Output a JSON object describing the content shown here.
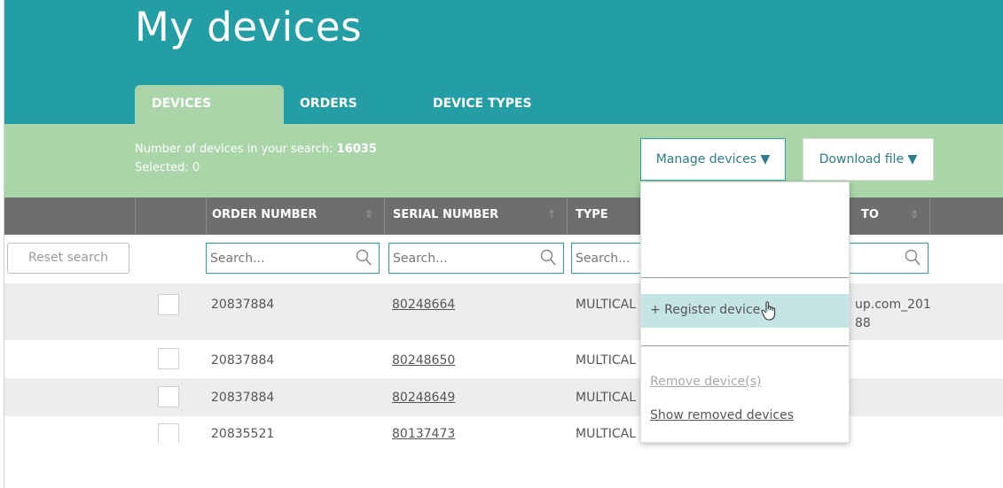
{
  "header": {
    "title": "My devices",
    "tabs": [
      {
        "label": "DEVICES",
        "active": true
      },
      {
        "label": "ORDERS",
        "active": false
      },
      {
        "label": "DEVICE TYPES",
        "active": false
      }
    ]
  },
  "summary": {
    "count_label": "Number of devices in your search: ",
    "count_value": "16035",
    "selected_label": "Selected: 0"
  },
  "actions": {
    "manage_label": "Manage devices ▼",
    "download_label": "Download file ▼"
  },
  "columns": {
    "order_number": "ORDER NUMBER",
    "serial_number": "SERIAL NUMBER",
    "type": "TYPE",
    "last": "TO"
  },
  "search": {
    "reset_label": "Reset search",
    "placeholder": "Search..."
  },
  "rows": [
    {
      "order": "20837884",
      "serial": "80248664",
      "type": "MULTICAL",
      "extra1": "up.com_201",
      "extra2": "88"
    },
    {
      "order": "20837884",
      "serial": "80248650",
      "type": "MULTICAL"
    },
    {
      "order": "20837884",
      "serial": "80248649",
      "type": "MULTICAL"
    },
    {
      "order": "20835521",
      "serial": "80137473",
      "type": "MULTICAL"
    }
  ],
  "menu": {
    "register_label": "+ Register device",
    "remove_label": "Remove device(s)",
    "show_removed_label": "Show removed devices"
  },
  "colors": {
    "header_teal": "#239ea4",
    "band_green": "#a9d5a8",
    "column_gray": "#6e6e6e",
    "highlight": "#c4e4e6"
  }
}
